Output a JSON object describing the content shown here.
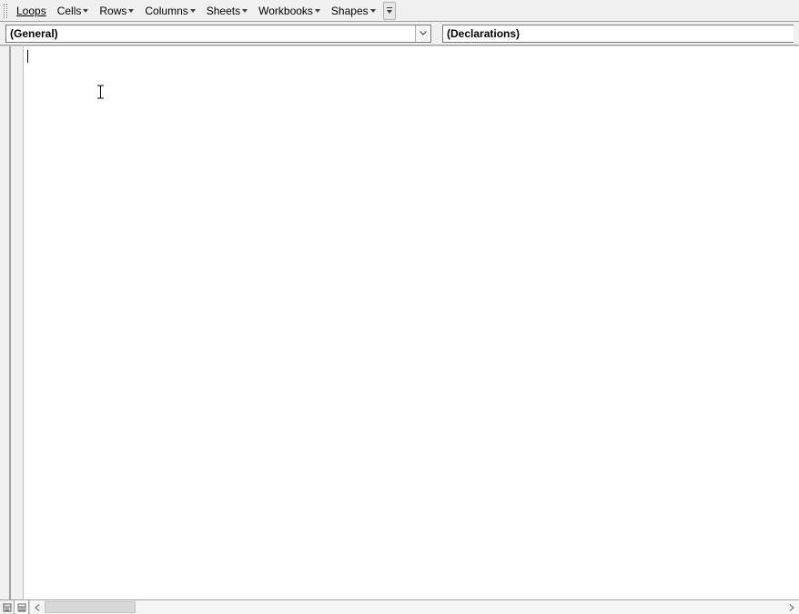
{
  "menubar": {
    "items": [
      {
        "label": "Loops",
        "accel_index": 0,
        "has_dropdown": false
      },
      {
        "label": "Cells",
        "accel_index": null,
        "has_dropdown": true
      },
      {
        "label": "Rows",
        "accel_index": null,
        "has_dropdown": true
      },
      {
        "label": "Columns",
        "accel_index": null,
        "has_dropdown": true
      },
      {
        "label": "Sheets",
        "accel_index": null,
        "has_dropdown": true
      },
      {
        "label": "Workbooks",
        "accel_index": null,
        "has_dropdown": true
      },
      {
        "label": "Shapes",
        "accel_index": null,
        "has_dropdown": true
      }
    ]
  },
  "dropdowns": {
    "object_selected": "(General)",
    "procedure_selected": "(Declarations)"
  },
  "editor": {
    "content": ""
  }
}
